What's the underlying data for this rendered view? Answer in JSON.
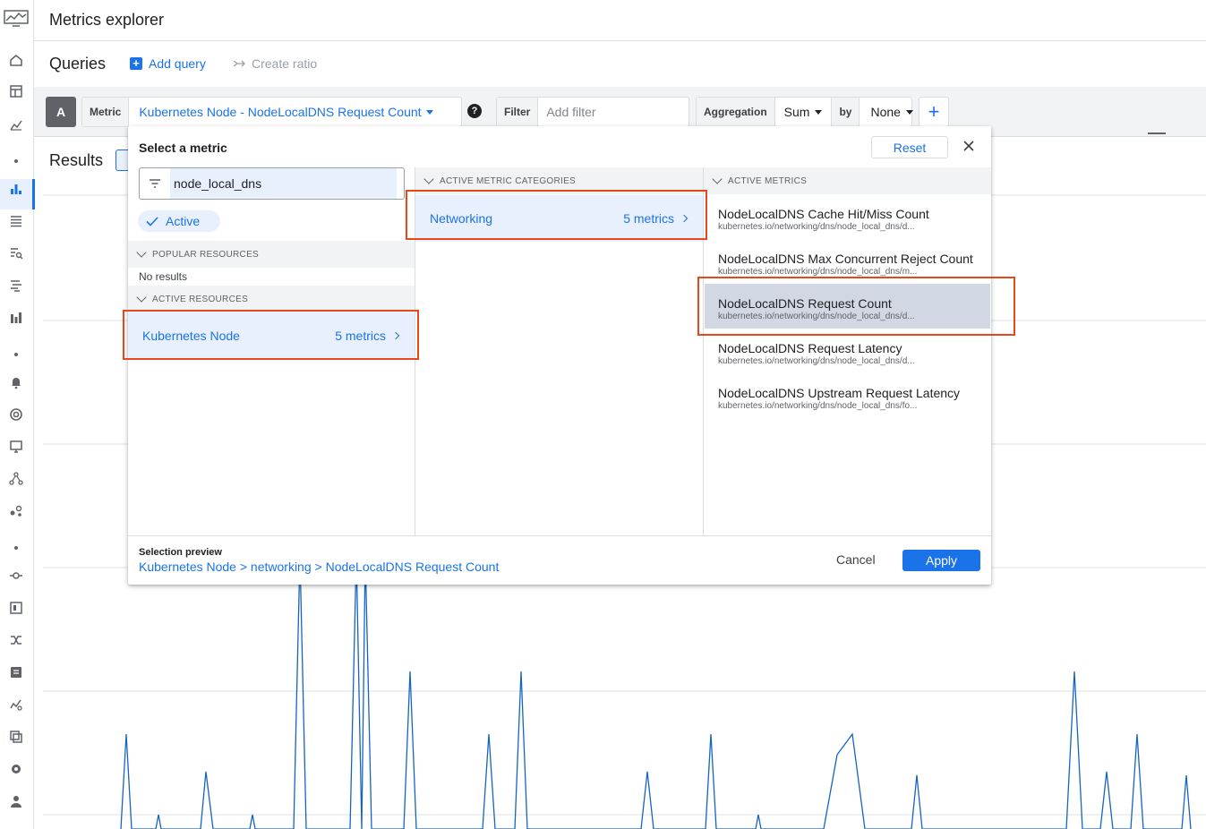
{
  "app": {
    "title": "Metrics explorer"
  },
  "queries": {
    "title": "Queries",
    "add_query": "Add query",
    "create_ratio": "Create ratio"
  },
  "query_row": {
    "letter": "A",
    "metric_label": "Metric",
    "metric_value": "Kubernetes Node - NodeLocalDNS Request Count",
    "filter_label": "Filter",
    "filter_placeholder": "Add filter",
    "aggregation_label": "Aggregation",
    "aggregation_value": "Sum",
    "by_label": "by",
    "by_value": "None"
  },
  "results": {
    "title": "Results"
  },
  "dialog": {
    "title": "Select a metric",
    "reset": "Reset",
    "search_value": "node_local_dns",
    "active_chip": "Active",
    "popular_header": "POPULAR RESOURCES",
    "no_results": "No results",
    "active_resources_header": "ACTIVE RESOURCES",
    "resources": [
      {
        "name": "Kubernetes Node",
        "count": "5 metrics"
      }
    ],
    "categories_header": "ACTIVE METRIC CATEGORIES",
    "categories": [
      {
        "name": "Networking",
        "count": "5 metrics"
      }
    ],
    "metrics_header": "ACTIVE METRICS",
    "metrics": [
      {
        "name": "NodeLocalDNS Cache Hit/Miss Count",
        "path": "kubernetes.io/networking/dns/node_local_dns/d..."
      },
      {
        "name": "NodeLocalDNS Max Concurrent Reject Count",
        "path": "kubernetes.io/networking/dns/node_local_dns/m..."
      },
      {
        "name": "NodeLocalDNS Request Count",
        "path": "kubernetes.io/networking/dns/node_local_dns/d..."
      },
      {
        "name": "NodeLocalDNS Request Latency",
        "path": "kubernetes.io/networking/dns/node_local_dns/d..."
      },
      {
        "name": "NodeLocalDNS Upstream Request Latency",
        "path": "kubernetes.io/networking/dns/node_local_dns/fo..."
      }
    ],
    "selected_metric_index": 2,
    "preview_label": "Selection preview",
    "preview_path": "Kubernetes Node > networking > NodeLocalDNS Request Count",
    "cancel": "Cancel",
    "apply": "Apply"
  },
  "rail_icons": [
    "home-icon",
    "dashboard-icon",
    "metrics-icon",
    "dot",
    "bar-chart-icon",
    "list-icon",
    "logs-search-icon",
    "trace-icon",
    "bar-stack-icon",
    "dot",
    "bell-icon",
    "sla-icon",
    "monitor-icon",
    "topology-icon",
    "graph-icon",
    "dot",
    "uptime-icon",
    "widget-icon",
    "shuffle-icon",
    "notes-icon",
    "anomaly-icon",
    "copy-icon",
    "gear-icon",
    "person-icon"
  ],
  "colors": {
    "accent": "#1a73e8",
    "highlight": "#e8471e",
    "line": "#1565c0"
  }
}
